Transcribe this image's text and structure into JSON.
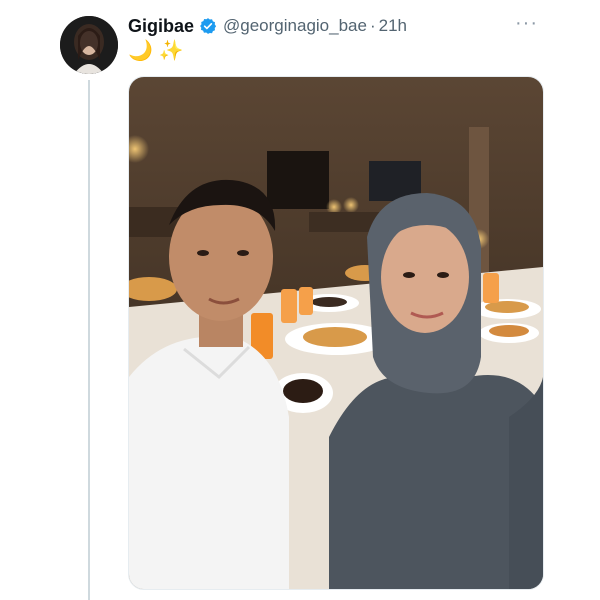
{
  "tweet": {
    "display_name": "Gigibae",
    "handle": "@georginagio_bae",
    "separator": "·",
    "timestamp": "21h",
    "text_emojis": [
      "🌙",
      "✨"
    ],
    "more_label": "···",
    "verified_color": "#1d9bf0"
  },
  "media": {
    "description_icon": "photo",
    "accent_colors": {
      "shirt": "#f4f4f4",
      "hijab": "#5a626c",
      "table": "#e9e1d6",
      "juice": "#f28c28"
    }
  }
}
